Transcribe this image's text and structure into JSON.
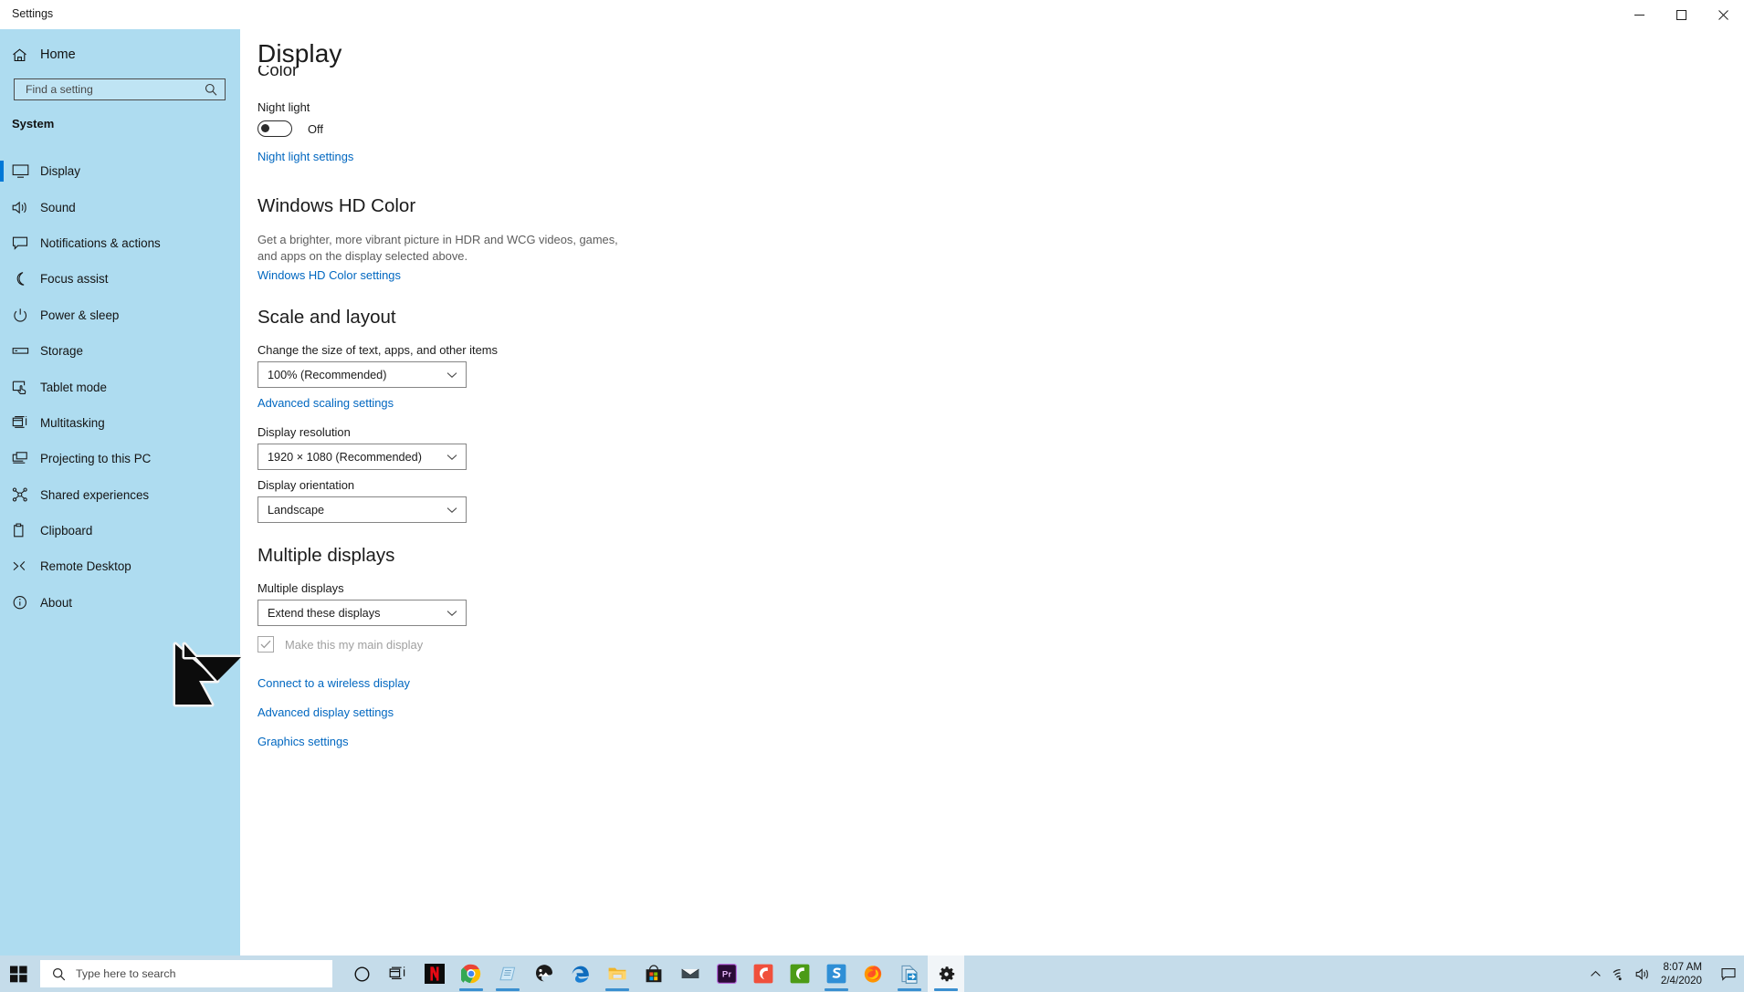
{
  "window": {
    "title": "Settings",
    "minimize_label": "Minimize",
    "maximize_label": "Maximize",
    "close_label": "Close"
  },
  "sidebar": {
    "home_label": "Home",
    "search": {
      "placeholder": "Find a setting"
    },
    "group_label": "System",
    "items": [
      {
        "label": "Display",
        "icon": "monitor-icon",
        "selected": true
      },
      {
        "label": "Sound",
        "icon": "speaker-icon",
        "selected": false
      },
      {
        "label": "Notifications & actions",
        "icon": "notification-icon",
        "selected": false
      },
      {
        "label": "Focus assist",
        "icon": "moon-icon",
        "selected": false
      },
      {
        "label": "Power & sleep",
        "icon": "power-icon",
        "selected": false
      },
      {
        "label": "Storage",
        "icon": "drive-icon",
        "selected": false
      },
      {
        "label": "Tablet mode",
        "icon": "tablet-icon",
        "selected": false
      },
      {
        "label": "Multitasking",
        "icon": "multitask-icon",
        "selected": false
      },
      {
        "label": "Projecting to this PC",
        "icon": "project-icon",
        "selected": false
      },
      {
        "label": "Shared experiences",
        "icon": "share-icon",
        "selected": false
      },
      {
        "label": "Clipboard",
        "icon": "clipboard-icon",
        "selected": false
      },
      {
        "label": "Remote Desktop",
        "icon": "remote-desktop-icon",
        "selected": false
      },
      {
        "label": "About",
        "icon": "info-icon",
        "selected": false
      }
    ]
  },
  "main": {
    "page_title": "Display",
    "color_heading": "Color",
    "night_light": {
      "label": "Night light",
      "state": "Off",
      "settings_link": "Night light settings"
    },
    "hd_color": {
      "heading": "Windows HD Color",
      "description_line1": "Get a brighter, more vibrant picture in HDR and WCG videos, games,",
      "description_line2": "and apps on the display selected above.",
      "settings_link": "Windows HD Color settings"
    },
    "scale_layout": {
      "heading": "Scale and layout",
      "scale_label": "Change the size of text, apps, and other items",
      "scale_value": "100% (Recommended)",
      "advanced_scaling_link": "Advanced scaling settings",
      "resolution_label": "Display resolution",
      "resolution_value": "1920 × 1080 (Recommended)",
      "orientation_label": "Display orientation",
      "orientation_value": "Landscape"
    },
    "multiple_displays": {
      "heading": "Multiple displays",
      "label": "Multiple displays",
      "value": "Extend these displays",
      "main_display_checkbox": "Make this my main display",
      "main_display_checked": true,
      "wireless_link": "Connect to a wireless display",
      "advanced_display_link": "Advanced display settings",
      "graphics_link": "Graphics settings"
    }
  },
  "taskbar": {
    "start_label": "Start",
    "search": {
      "placeholder": "Type here to search"
    },
    "items": [
      {
        "name": "cortana",
        "label": "Cortana",
        "running": false,
        "active": false
      },
      {
        "name": "task-view",
        "label": "Task View",
        "running": false,
        "active": false
      },
      {
        "name": "netflix",
        "label": "Netflix",
        "running": false,
        "active": false
      },
      {
        "name": "google-chrome",
        "label": "Google Chrome",
        "running": true,
        "active": false
      },
      {
        "name": "notepad",
        "label": "Notepad",
        "running": true,
        "active": false
      },
      {
        "name": "photos",
        "label": "Photos",
        "running": false,
        "active": false
      },
      {
        "name": "microsoft-edge",
        "label": "Microsoft Edge",
        "running": false,
        "active": false
      },
      {
        "name": "file-explorer",
        "label": "File Explorer",
        "running": true,
        "active": false
      },
      {
        "name": "microsoft-store",
        "label": "Microsoft Store",
        "running": false,
        "active": false
      },
      {
        "name": "mail",
        "label": "Mail",
        "running": false,
        "active": false
      },
      {
        "name": "premiere-pro",
        "label": "Adobe Premiere Pro",
        "running": false,
        "active": false
      },
      {
        "name": "camtasia",
        "label": "Camtasia",
        "running": false,
        "active": false
      },
      {
        "name": "camtasia-editor",
        "label": "Camtasia Editor",
        "running": false,
        "active": false
      },
      {
        "name": "snagit",
        "label": "Snagit",
        "running": true,
        "active": false
      },
      {
        "name": "firefox",
        "label": "Mozilla Firefox",
        "running": false,
        "active": false
      },
      {
        "name": "file-transfer",
        "label": "File Transfer",
        "running": true,
        "active": false
      },
      {
        "name": "settings",
        "label": "Settings",
        "running": true,
        "active": true
      }
    ],
    "tray": {
      "show_hidden_label": "Show hidden icons",
      "network_label": "Network",
      "volume_label": "Volume",
      "time": "8:07 AM",
      "date": "2/4/2020",
      "action_center_label": "Action Center"
    }
  },
  "colors": {
    "sidebar_bg": "#aedcf0",
    "taskbar_bg": "#c5dcea",
    "accent": "#0078d7",
    "link": "#0067c0"
  }
}
